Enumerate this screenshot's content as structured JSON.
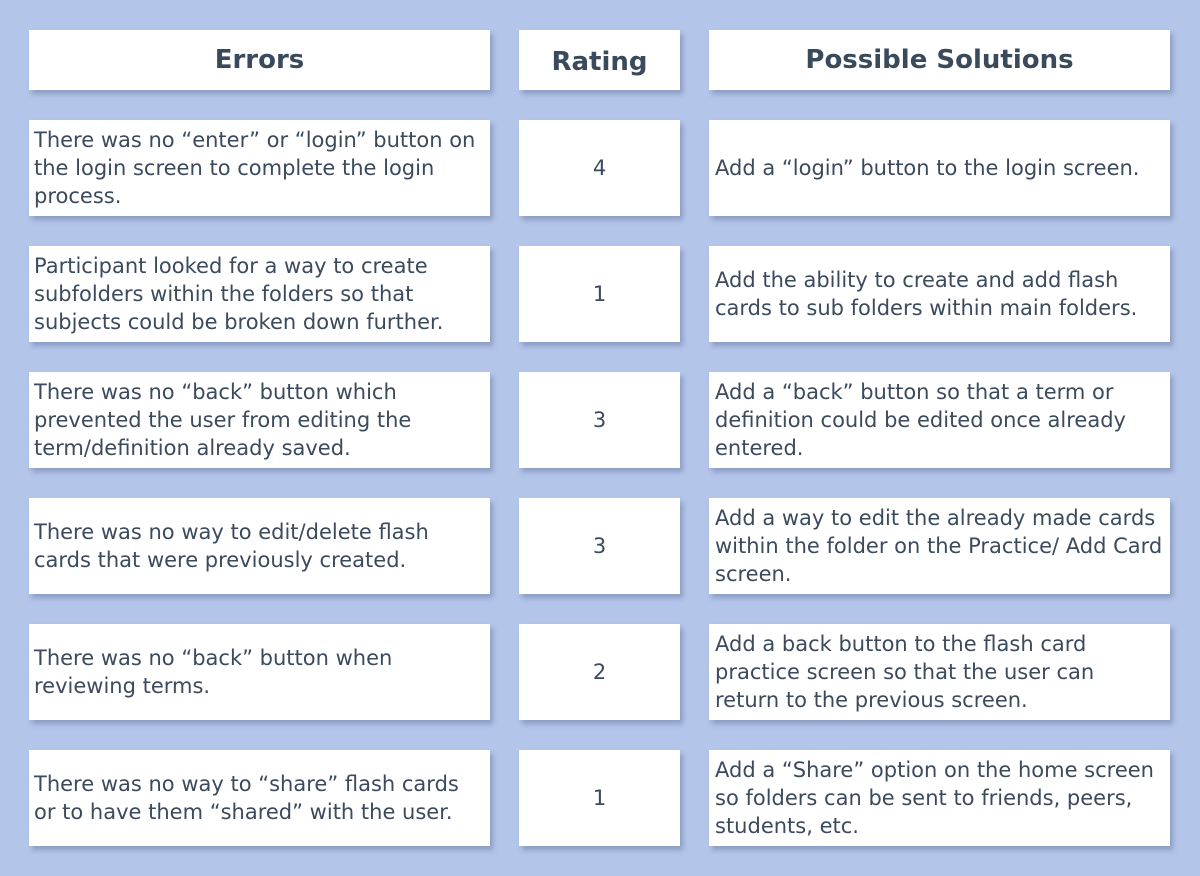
{
  "headers": {
    "errors": "Errors",
    "rating": "Rating",
    "solutions": "Possible Solutions"
  },
  "rows": [
    {
      "error": "There was no “enter” or “login” button on the login screen to complete the login process.",
      "rating": "4",
      "solution": "Add a “login” button to the login screen."
    },
    {
      "error": "Participant looked for a way to create subfolders within the folders so that subjects could be broken down further.",
      "rating": "1",
      "solution": "Add the ability to create and add flash cards to sub folders within main folders."
    },
    {
      "error": "There was no “back” button which prevented the user from editing the term/definition already saved.",
      "rating": "3",
      "solution": "Add a “back” button so that a term or definition could be edited once already entered."
    },
    {
      "error": "There was no way to edit/delete flash cards that were previously created.",
      "rating": "3",
      "solution": "Add a way to edit the already made cards within the folder on the Practice/ Add Card screen."
    },
    {
      "error": "There was no “back” button when reviewing terms.",
      "rating": "2",
      "solution": "Add a back button to the flash card practice screen so that the user can return to the previous screen."
    },
    {
      "error": "There was no way to “share” flash cards or to have them “shared” with the user.",
      "rating": "1",
      "solution": "Add a “Share” option on the home screen so folders can be sent to friends, peers, students, etc."
    }
  ]
}
